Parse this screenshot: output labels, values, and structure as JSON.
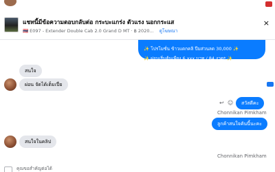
{
  "header": {
    "title": "แชทนี้มีข้อความตอบกลับต่อ กระบะแกร่ง ตัวแรง นอกกระแส",
    "subtitle_flag": "🇹🇭",
    "subtitle": "E097 - Extender Double Cab 2.0 Grand D MT · ฿ 2020...",
    "view_link": "ดูโฆษณา",
    "close_label": "×"
  },
  "messages": {
    "big_bubble_line1": "✨ โปรโมชั่น ข้าวแดกคลิ ปีมส่วนลด 30,000 ✨",
    "big_bubble_line2": "✨ ผ่อนเริ่มต้นเพียง 6,xxx บาท / 84 งวด* ✨",
    "in1": "สนใจ",
    "in2": "ผ่อน จัดได้เต็มเปี่ย",
    "out1": "สวัสดีคะ",
    "sender1": "Chonnikan Pimkham",
    "out2": "ลูกค้าสนใจคันนี้นะคะ",
    "in3": "สนใจในคลิป",
    "sender2": "Chonnikan Pimkham",
    "bottom_text": "คุณขอสำคัญต่อได้"
  },
  "colors": {
    "accent": "#0a7cff",
    "incoming_bg": "#e4e6eb",
    "meta_text": "#65676b"
  },
  "icons": {
    "reply": "reply-icon",
    "smile": "smile-icon",
    "close": "close-icon"
  }
}
